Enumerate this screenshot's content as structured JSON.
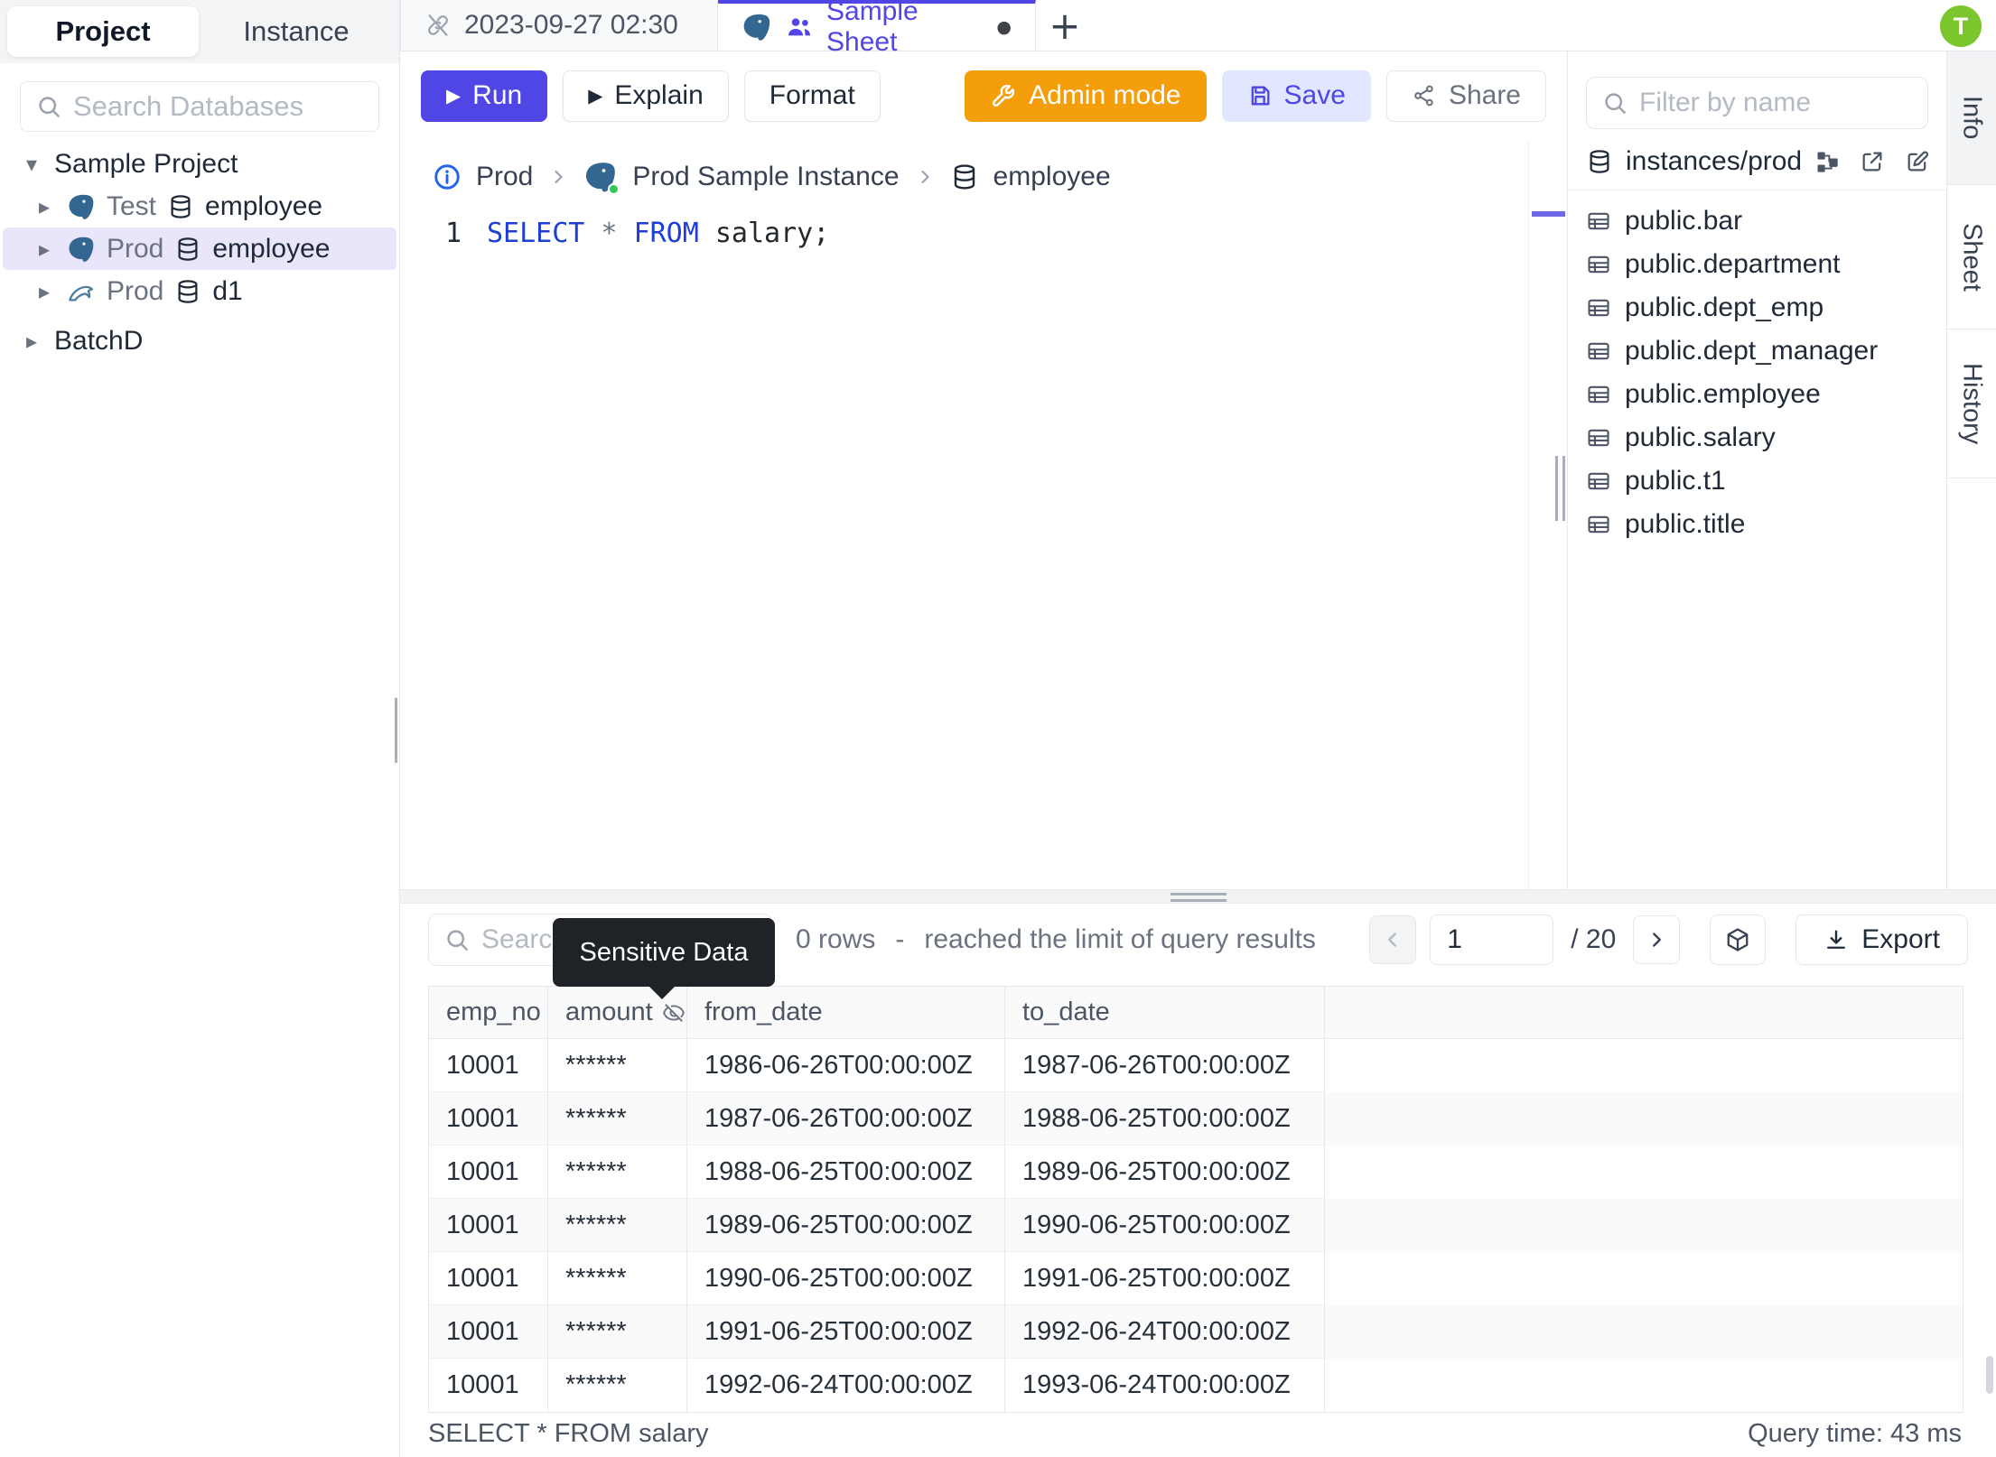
{
  "icons": {
    "caret_down": "▾",
    "caret_right": "▸",
    "play": "▶",
    "dot": "●",
    "plus": "+"
  },
  "colors": {
    "accent": "#4f46e5",
    "admin_orange": "#f59e0b",
    "save_bg": "#e0e7ff",
    "selected_row": "#e9e5fb",
    "avatar_green": "#7bc62d",
    "tooltip_bg": "#1f2328"
  },
  "sidebar": {
    "tabs": {
      "project": "Project",
      "instance": "Instance"
    },
    "search_placeholder": "Search Databases",
    "tree": {
      "project_label": "Sample Project",
      "items": [
        {
          "env": "Test",
          "db": "employee"
        },
        {
          "env": "Prod",
          "db": "employee"
        },
        {
          "env": "Prod",
          "db": "d1"
        }
      ],
      "batch_label": "BatchD"
    }
  },
  "tabbar": {
    "history_tab": "2023-09-27 02:30",
    "sheet_tab": "Sample Sheet"
  },
  "toolbar": {
    "run": "Run",
    "explain": "Explain",
    "format": "Format",
    "admin": "Admin mode",
    "save": "Save",
    "share": "Share"
  },
  "breadcrumb": {
    "env": "Prod",
    "instance": "Prod Sample Instance",
    "db": "employee"
  },
  "editor": {
    "line_number": "1",
    "kw1": "SELECT",
    "star": "*",
    "kw2": "FROM",
    "rest": " salary;"
  },
  "schema_panel": {
    "filter_placeholder": "Filter by name",
    "connection": "instances/prod",
    "tables": [
      "public.bar",
      "public.department",
      "public.dept_emp",
      "public.dept_manager",
      "public.employee",
      "public.salary",
      "public.t1",
      "public.title"
    ]
  },
  "side_tabs": [
    "Info",
    "Sheet",
    "History"
  ],
  "results": {
    "search_placeholder": "Search",
    "tooltip": "Sensitive Data",
    "row_count": "0 rows",
    "dash": "-",
    "limit_message": "reached the limit of query results",
    "pagination": {
      "page": "1",
      "total": "/ 20"
    },
    "export_label": "Export",
    "table": {
      "headers": [
        "emp_no",
        "amount",
        "from_date",
        "to_date"
      ],
      "rows": [
        [
          "10001",
          "******",
          "1986-06-26T00:00:00Z",
          "1987-06-26T00:00:00Z"
        ],
        [
          "10001",
          "******",
          "1987-06-26T00:00:00Z",
          "1988-06-25T00:00:00Z"
        ],
        [
          "10001",
          "******",
          "1988-06-25T00:00:00Z",
          "1989-06-25T00:00:00Z"
        ],
        [
          "10001",
          "******",
          "1989-06-25T00:00:00Z",
          "1990-06-25T00:00:00Z"
        ],
        [
          "10001",
          "******",
          "1990-06-25T00:00:00Z",
          "1991-06-25T00:00:00Z"
        ],
        [
          "10001",
          "******",
          "1991-06-25T00:00:00Z",
          "1992-06-24T00:00:00Z"
        ],
        [
          "10001",
          "******",
          "1992-06-24T00:00:00Z",
          "1993-06-24T00:00:00Z"
        ]
      ]
    },
    "status_left": "SELECT * FROM salary",
    "status_right": "Query time: 43 ms"
  },
  "avatar": "T"
}
